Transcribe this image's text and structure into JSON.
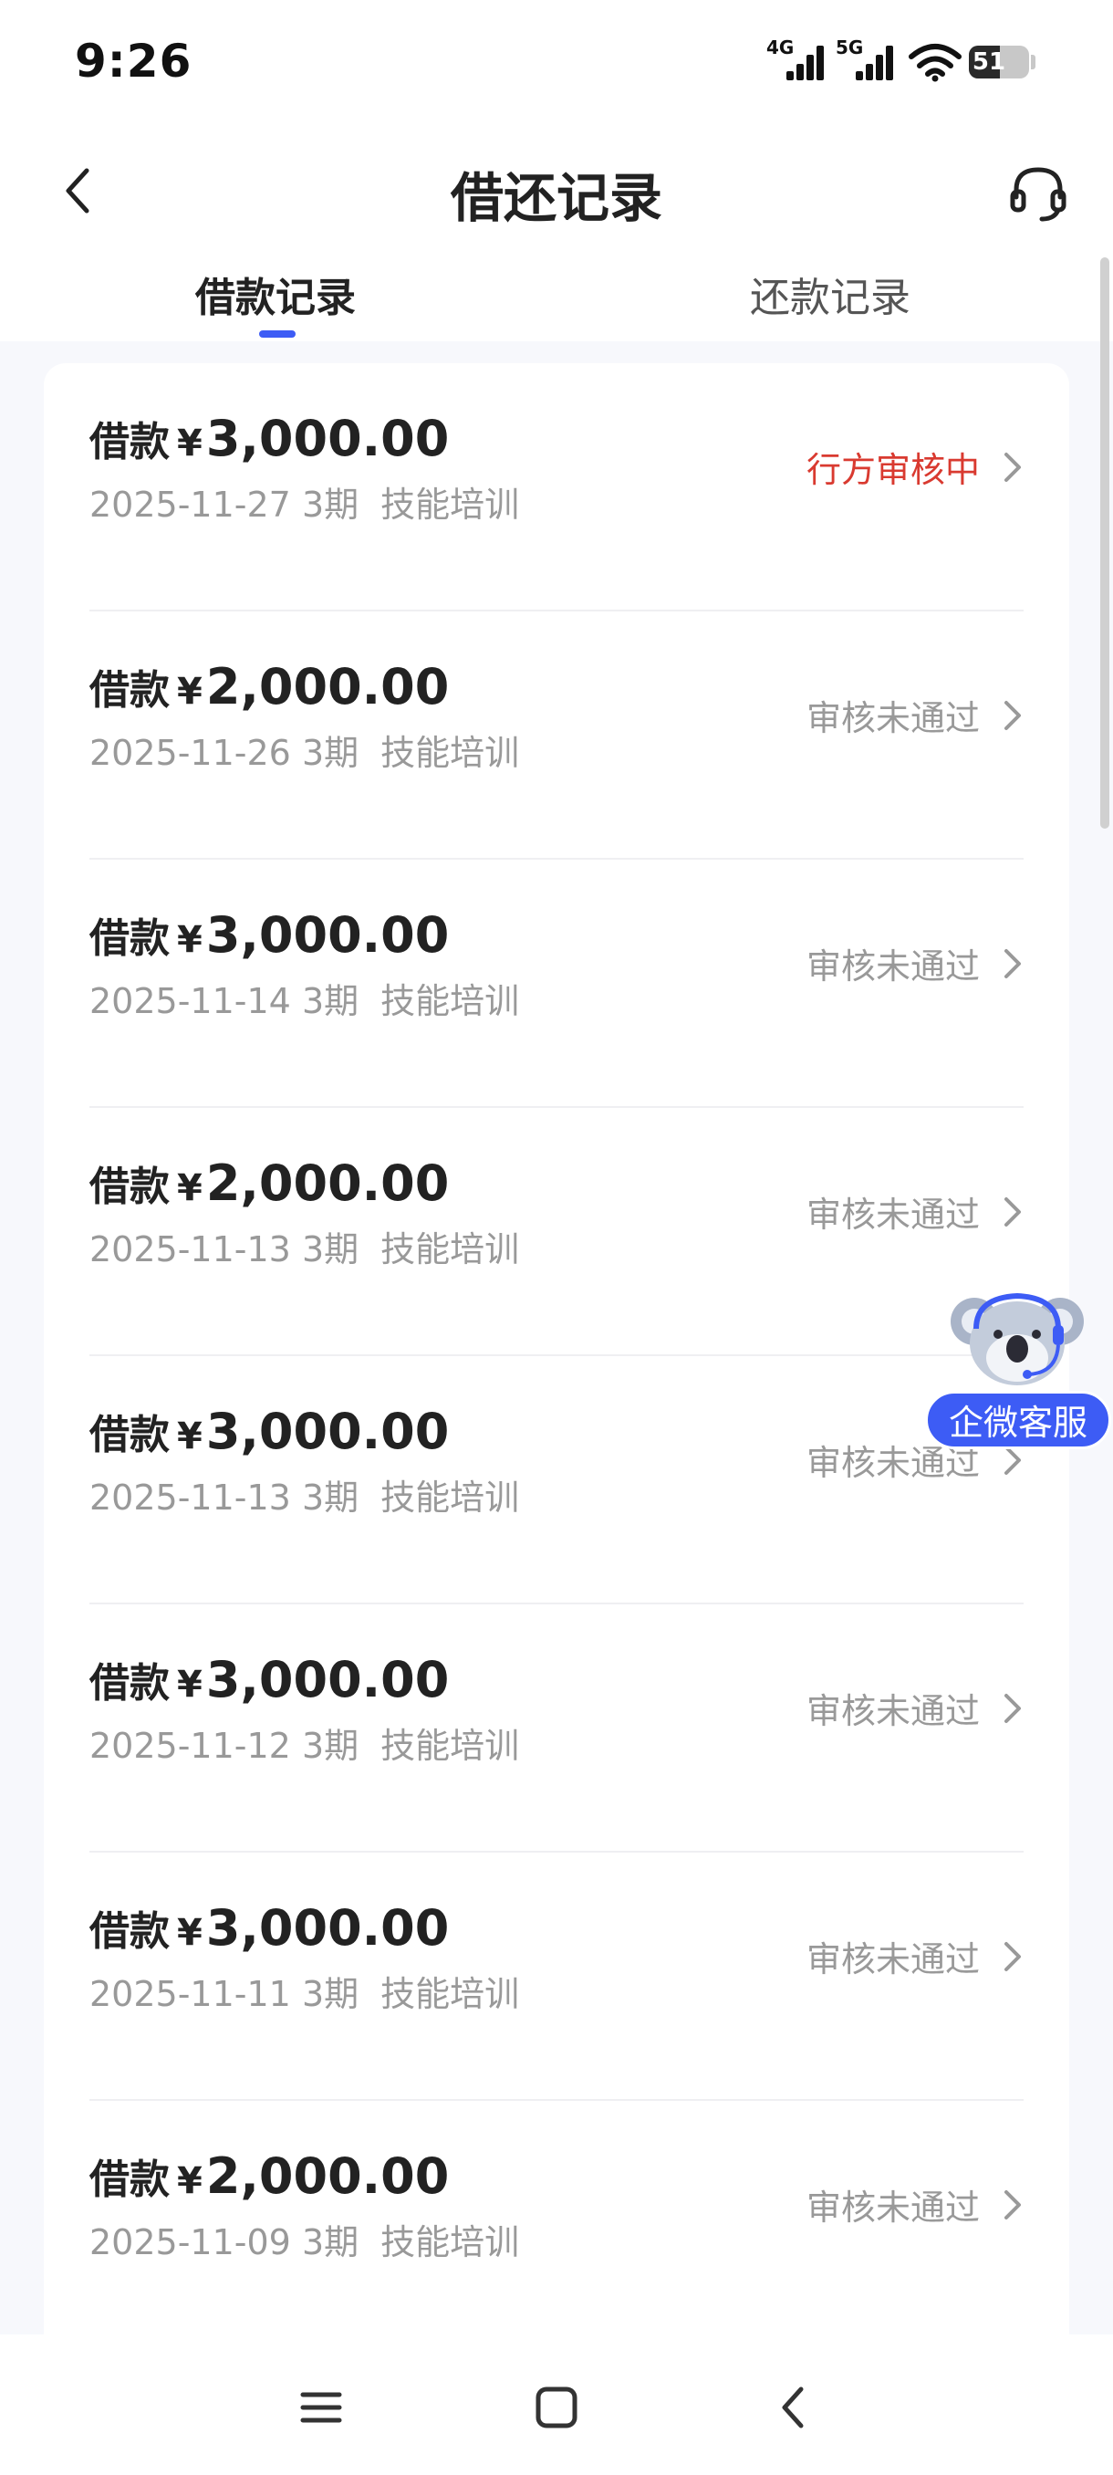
{
  "status_bar": {
    "time": "9:26",
    "network_1": "4G",
    "network_2": "5G",
    "battery": "51",
    "battery_level": 0.51
  },
  "header": {
    "title": "借还记录"
  },
  "tabs": [
    {
      "label": "借款记录",
      "active": true
    },
    {
      "label": "还款记录",
      "active": false
    }
  ],
  "records": [
    {
      "prefix": "借款",
      "currency": "¥",
      "amount": "3,000.00",
      "date": "2025-11-27",
      "term": "3期",
      "purpose": "技能培训",
      "status": "行方审核中"
    },
    {
      "prefix": "借款",
      "currency": "¥",
      "amount": "2,000.00",
      "date": "2025-11-26",
      "term": "3期",
      "purpose": "技能培训",
      "status": "审核未通过"
    },
    {
      "prefix": "借款",
      "currency": "¥",
      "amount": "3,000.00",
      "date": "2025-11-14",
      "term": "3期",
      "purpose": "技能培训",
      "status": "审核未通过"
    },
    {
      "prefix": "借款",
      "currency": "¥",
      "amount": "2,000.00",
      "date": "2025-11-13",
      "term": "3期",
      "purpose": "技能培训",
      "status": "审核未通过"
    },
    {
      "prefix": "借款",
      "currency": "¥",
      "amount": "3,000.00",
      "date": "2025-11-13",
      "term": "3期",
      "purpose": "技能培训",
      "status": "审核未通过"
    },
    {
      "prefix": "借款",
      "currency": "¥",
      "amount": "3,000.00",
      "date": "2025-11-12",
      "term": "3期",
      "purpose": "技能培训",
      "status": "审核未通过"
    },
    {
      "prefix": "借款",
      "currency": "¥",
      "amount": "3,000.00",
      "date": "2025-11-11",
      "term": "3期",
      "purpose": "技能培训",
      "status": "审核未通过"
    },
    {
      "prefix": "借款",
      "currency": "¥",
      "amount": "2,000.00",
      "date": "2025-11-09",
      "term": "3期",
      "purpose": "技能培训",
      "status": "审核未通过"
    }
  ],
  "floating_service": {
    "label": "企微客服"
  },
  "colors": {
    "accent": "#3d5cf5",
    "pending": "#d93a30",
    "muted": "#999999"
  },
  "icons": {
    "back": "chevron-left-icon",
    "support": "headset-icon",
    "row": "chevron-right-icon",
    "mascot": "koala-icon"
  },
  "nav": {
    "menu": "menu-icon",
    "home": "home-icon",
    "back": "back-icon"
  }
}
